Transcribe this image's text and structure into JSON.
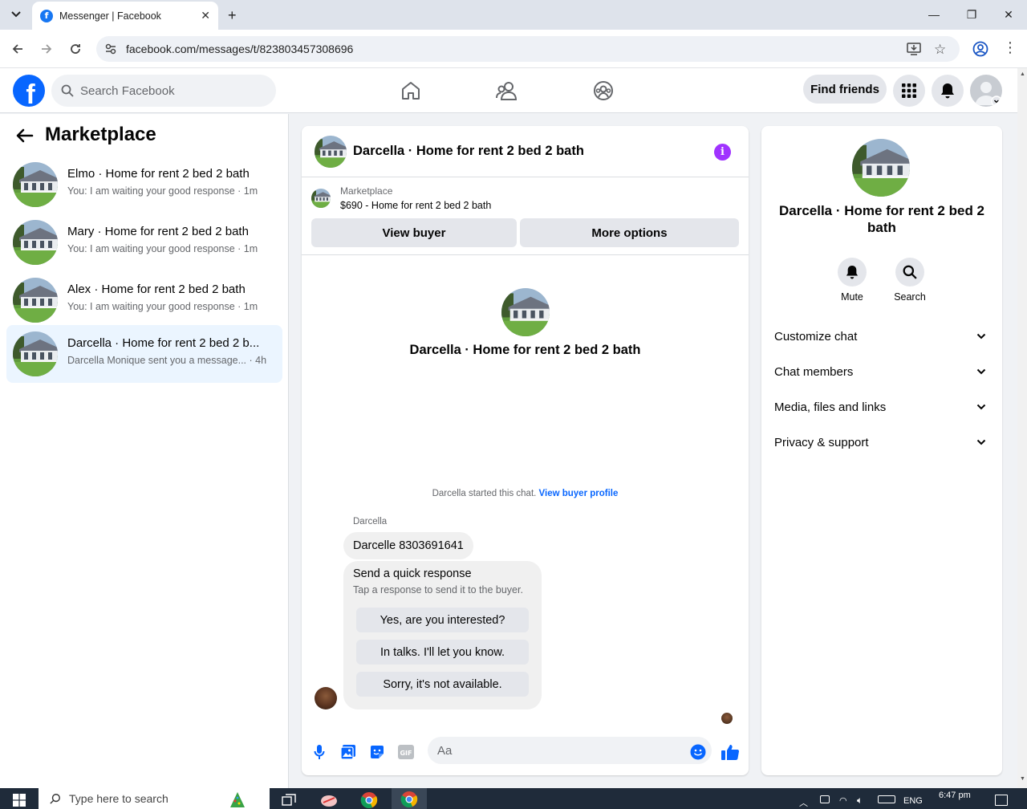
{
  "browser": {
    "tab_title": "Messenger | Facebook",
    "url": "facebook.com/messages/t/823803457308696"
  },
  "header": {
    "search_placeholder": "Search Facebook",
    "find_friends": "Find friends",
    "nav_icons": [
      "home-icon",
      "friends-icon",
      "groups-icon"
    ]
  },
  "sidebar": {
    "title": "Marketplace",
    "conversations": [
      {
        "name": "Elmo · Home for rent 2 bed 2 bath",
        "preview": "You: I am waiting your good response · 1m",
        "active": false
      },
      {
        "name": "Mary · Home for rent 2 bed 2 bath",
        "preview": "You: I am waiting your good response · 1m",
        "active": false
      },
      {
        "name": "Alex · Home for rent 2 bed 2 bath",
        "preview": "You: I am waiting your good response · 1m",
        "active": false
      },
      {
        "name": "Darcella · Home for rent 2 bed 2 b...",
        "preview": "Darcella Monique sent you a message... · 4h",
        "active": true
      }
    ]
  },
  "chat": {
    "title": "Darcella · Home for rent 2 bed 2 bath",
    "listing_source": "Marketplace",
    "listing_price": "$690 - Home for rent 2 bed 2 bath",
    "view_buyer": "View buyer",
    "more_options": "More options",
    "intro_name": "Darcella · Home for rent 2 bed 2 bath",
    "started_text": "Darcella started this chat.",
    "view_buyer_profile": "View buyer profile",
    "sender_name": "Darcella",
    "message": "Darcelle 8303691641",
    "quick_response": {
      "title": "Send a quick response",
      "subtitle": "Tap a response to send it to the buyer.",
      "options": [
        "Yes, are you interested?",
        "In talks. I'll let you know.",
        "Sorry, it's not available."
      ]
    },
    "input_placeholder": "Aa"
  },
  "details": {
    "name": "Darcella · Home for rent 2 bed 2 bath",
    "mute": "Mute",
    "search": "Search",
    "sections": [
      "Customize chat",
      "Chat members",
      "Media, files and links",
      "Privacy & support"
    ]
  },
  "taskbar": {
    "search_placeholder": "Type here to search",
    "lang": "ENG",
    "time": "6:47 pm"
  },
  "colors": {
    "brand": "#0866ff",
    "accent_info": "#a033ff",
    "active_row": "#ebf5ff"
  }
}
